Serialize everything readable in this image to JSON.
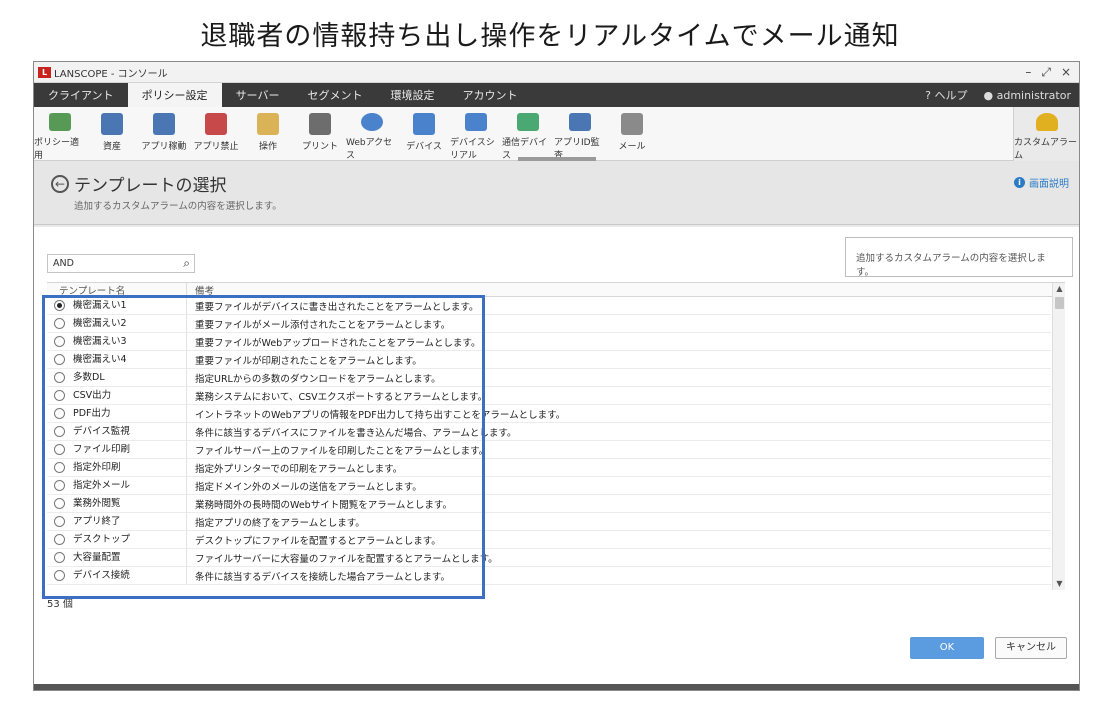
{
  "slide_title": "退職者の情報持ち出し操作をリアルタイムでメール通知",
  "window": {
    "title": "LANSCOPE - コンソール",
    "controls": [
      "–",
      "⤢",
      "×"
    ]
  },
  "menu": {
    "items": [
      "クライアント",
      "ポリシー設定",
      "サーバー",
      "セグメント",
      "環境設定",
      "アカウント"
    ],
    "active_index": 1,
    "help": "ヘルプ",
    "user": "administrator"
  },
  "toolbar": {
    "items": [
      {
        "label": "ポリシー適用",
        "icon": "policy-apply-icon",
        "color": "#3a8a3a"
      },
      {
        "label": "資産",
        "icon": "asset-icon",
        "color": "#2b5fa8"
      },
      {
        "label": "アプリ稼動",
        "icon": "app-run-icon",
        "color": "#2b5fa8"
      },
      {
        "label": "アプリ禁止",
        "icon": "app-block-icon",
        "color": "#c02a2a"
      },
      {
        "label": "操作",
        "icon": "operation-icon",
        "color": "#d4a73a"
      },
      {
        "label": "プリント",
        "icon": "print-icon",
        "color": "#555555"
      },
      {
        "label": "Webアクセス",
        "icon": "web-access-icon",
        "color": "#2b6fc4"
      },
      {
        "label": "デバイス",
        "icon": "device-icon",
        "color": "#2b6fc4"
      },
      {
        "label": "デバイスシリアル",
        "icon": "device-serial-icon",
        "color": "#2b6fc4"
      },
      {
        "label": "通信デバイス",
        "icon": "comm-device-icon",
        "color": "#2b9a5a"
      },
      {
        "label": "アプリID監査",
        "icon": "app-id-icon",
        "color": "#2b5fa8"
      },
      {
        "label": "メール",
        "icon": "mail-icon",
        "color": "#777777"
      }
    ],
    "alarm_label": "カスタムアラーム"
  },
  "header": {
    "title": "テンプレートの選択",
    "subtitle": "追加するカスタムアラームの内容を選択します。",
    "help_link": "画面説明"
  },
  "search": {
    "value": "AND"
  },
  "description_panel": "追加するカスタムアラームの内容を選択します。",
  "grid": {
    "columns": [
      "テンプレート名",
      "備考"
    ],
    "rows": [
      {
        "name": "機密漏えい1",
        "note": "重要ファイルがデバイスに書き出されたことをアラームとします。",
        "selected": true
      },
      {
        "name": "機密漏えい2",
        "note": "重要ファイルがメール添付されたことをアラームとします。",
        "selected": false
      },
      {
        "name": "機密漏えい3",
        "note": "重要ファイルがWebアップロードされたことをアラームとします。",
        "selected": false
      },
      {
        "name": "機密漏えい4",
        "note": "重要ファイルが印刷されたことをアラームとします。",
        "selected": false
      },
      {
        "name": "多数DL",
        "note": "指定URLからの多数のダウンロードをアラームとします。",
        "selected": false
      },
      {
        "name": "CSV出力",
        "note": "業務システムにおいて、CSVエクスポートするとアラームとします。",
        "selected": false
      },
      {
        "name": "PDF出力",
        "note": "イントラネットのWebアプリの情報をPDF出力して持ち出すことをアラームとします。",
        "selected": false
      },
      {
        "name": "デバイス監視",
        "note": "条件に該当するデバイスにファイルを書き込んだ場合、アラームとします。",
        "selected": false
      },
      {
        "name": "ファイル印刷",
        "note": "ファイルサーバー上のファイルを印刷したことをアラームとします。",
        "selected": false
      },
      {
        "name": "指定外印刷",
        "note": "指定外プリンターでの印刷をアラームとします。",
        "selected": false
      },
      {
        "name": "指定外メール",
        "note": "指定ドメイン外のメールの送信をアラームとします。",
        "selected": false
      },
      {
        "name": "業務外閲覧",
        "note": "業務時間外の長時間のWebサイト閲覧をアラームとします。",
        "selected": false
      },
      {
        "name": "アプリ終了",
        "note": "指定アプリの終了をアラームとします。",
        "selected": false
      },
      {
        "name": "デスクトップ",
        "note": "デスクトップにファイルを配置するとアラームとします。",
        "selected": false
      },
      {
        "name": "大容量配置",
        "note": "ファイルサーバーに大容量のファイルを配置するとアラームとします。",
        "selected": false
      },
      {
        "name": "デバイス接続",
        "note": "条件に該当するデバイスを接続した場合アラームとします。",
        "selected": false
      }
    ]
  },
  "count_text": "53 個",
  "buttons": {
    "ok": "OK",
    "cancel": "キャンセル"
  }
}
